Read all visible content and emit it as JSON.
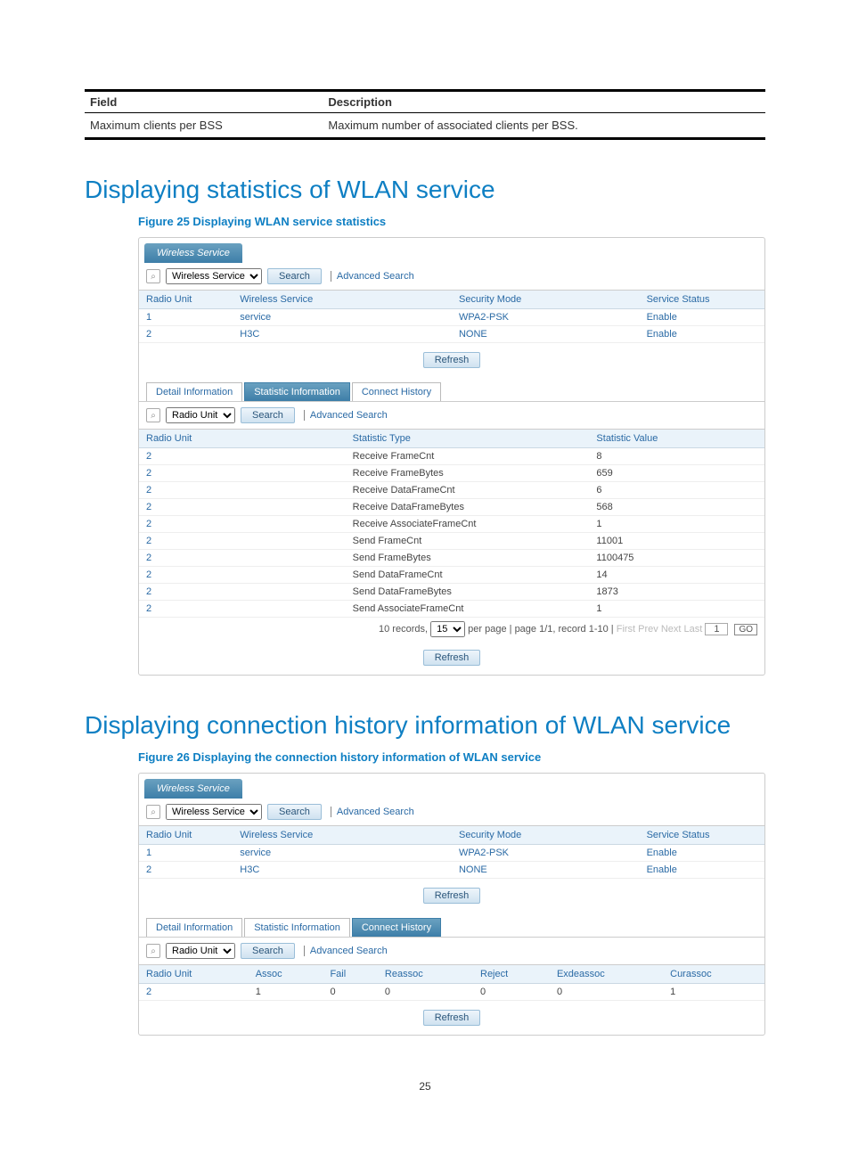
{
  "doc_table": {
    "headers": [
      "Field",
      "Description"
    ],
    "row": [
      "Maximum clients per BSS",
      "Maximum number of associated clients per BSS."
    ]
  },
  "section1": {
    "heading": "Displaying statistics of WLAN service",
    "figure_caption": "Figure 25 Displaying WLAN service statistics"
  },
  "shot1": {
    "tab": "Wireless Service",
    "select1": "Wireless Service",
    "search_btn": "Search",
    "adv": "Advanced Search",
    "top_headers": [
      "Radio Unit",
      "Wireless Service",
      "Security Mode",
      "Service Status"
    ],
    "top_rows": [
      {
        "ru": "1",
        "ws": "service",
        "sm": "WPA2-PSK",
        "ss": "Enable"
      },
      {
        "ru": "2",
        "ws": "H3C",
        "sm": "NONE",
        "ss": "Enable"
      }
    ],
    "refresh": "Refresh",
    "tabs": {
      "detail": "Detail Information",
      "stat": "Statistic Information",
      "conn": "Connect History"
    },
    "select2": "Radio Unit",
    "stat_headers": [
      "Radio Unit",
      "Statistic Type",
      "Statistic Value"
    ],
    "stat_rows": [
      {
        "ru": "2",
        "t": "Receive FrameCnt",
        "v": "8"
      },
      {
        "ru": "2",
        "t": "Receive FrameBytes",
        "v": "659"
      },
      {
        "ru": "2",
        "t": "Receive DataFrameCnt",
        "v": "6"
      },
      {
        "ru": "2",
        "t": "Receive DataFrameBytes",
        "v": "568"
      },
      {
        "ru": "2",
        "t": "Receive AssociateFrameCnt",
        "v": "1"
      },
      {
        "ru": "2",
        "t": "Send FrameCnt",
        "v": "11001"
      },
      {
        "ru": "2",
        "t": "Send FrameBytes",
        "v": "1100475"
      },
      {
        "ru": "2",
        "t": "Send DataFrameCnt",
        "v": "14"
      },
      {
        "ru": "2",
        "t": "Send DataFrameBytes",
        "v": "1873"
      },
      {
        "ru": "2",
        "t": "Send AssociateFrameCnt",
        "v": "1"
      }
    ],
    "pager": {
      "records": "10 records,",
      "per": "15",
      "perpage": "per page | page 1/1, record 1-10 |",
      "nav": "First  Prev  Next  Last",
      "page": "1",
      "go": "GO"
    }
  },
  "section2": {
    "heading": "Displaying connection history information of WLAN service",
    "figure_caption": "Figure 26 Displaying the connection history information of WLAN service"
  },
  "shot2": {
    "tab": "Wireless Service",
    "select1": "Wireless Service",
    "search_btn": "Search",
    "adv": "Advanced Search",
    "top_headers": [
      "Radio Unit",
      "Wireless Service",
      "Security Mode",
      "Service Status"
    ],
    "top_rows": [
      {
        "ru": "1",
        "ws": "service",
        "sm": "WPA2-PSK",
        "ss": "Enable"
      },
      {
        "ru": "2",
        "ws": "H3C",
        "sm": "NONE",
        "ss": "Enable"
      }
    ],
    "refresh": "Refresh",
    "tabs": {
      "detail": "Detail Information",
      "stat": "Statistic Information",
      "conn": "Connect History"
    },
    "select2": "Radio Unit",
    "conn_headers": [
      "Radio Unit",
      "Assoc",
      "Fail",
      "Reassoc",
      "Reject",
      "Exdeassoc",
      "Curassoc"
    ],
    "conn_row": {
      "ru": "2",
      "assoc": "1",
      "fail": "0",
      "reassoc": "0",
      "reject": "0",
      "ex": "0",
      "cur": "1"
    }
  },
  "page_number": "25"
}
